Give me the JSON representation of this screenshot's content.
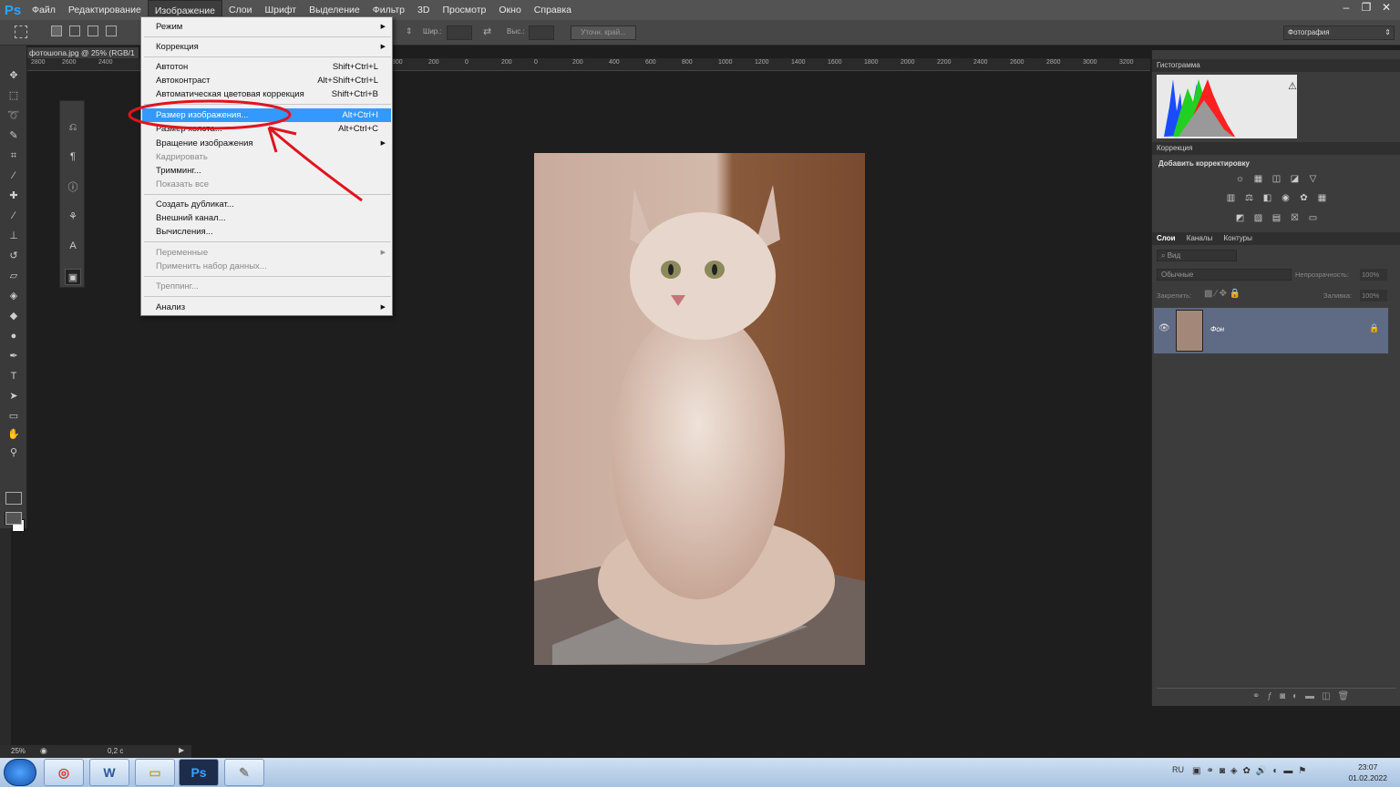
{
  "app": {
    "logo": "Ps"
  },
  "menubar": {
    "items": [
      "Файл",
      "Редактирование",
      "Изображение",
      "Слои",
      "Шрифт",
      "Выделение",
      "Фильтр",
      "3D",
      "Просмотр",
      "Окно",
      "Справка"
    ],
    "active": "Изображение"
  },
  "window_controls": [
    "–",
    "❐",
    "✕"
  ],
  "options_bar": {
    "width_label": "Шир.:",
    "height_label": "Выс.:",
    "refine_edge": "Уточн. край...",
    "workspace": "Фотография"
  },
  "document": {
    "tab_title": "фотошопа.jpg @ 25% (RGB/1",
    "ruler_ticks": [
      "2800",
      "2600",
      "2400",
      "2200",
      "300",
      "200",
      "400",
      "600",
      "800",
      "1000",
      "1200",
      "1400",
      "1600",
      "1800",
      "2000",
      "2200",
      "2400",
      "2600",
      "2800",
      "3000",
      "3200"
    ],
    "ruler_ticks_right": [
      "300",
      "200",
      "0",
      "200",
      "400",
      "600",
      "800",
      "1000",
      "1200",
      "1400",
      "1600",
      "1800",
      "2000",
      "2200",
      "2400",
      "2600",
      "2800",
      "3000",
      "3200"
    ]
  },
  "image_menu": {
    "items": [
      {
        "label": "Режим",
        "shortcut": "",
        "submenu": true,
        "disabled": false
      },
      {
        "label": "Коррекция",
        "shortcut": "",
        "submenu": true,
        "disabled": false
      },
      {
        "label": "Автотон",
        "shortcut": "Shift+Ctrl+L",
        "submenu": false,
        "disabled": false
      },
      {
        "label": "Автоконтраст",
        "shortcut": "Alt+Shift+Ctrl+L",
        "submenu": false,
        "disabled": false
      },
      {
        "label": "Автоматическая цветовая коррекция",
        "shortcut": "Shift+Ctrl+B",
        "submenu": false,
        "disabled": false
      },
      {
        "label": "Размер изображения...",
        "shortcut": "Alt+Ctrl+I",
        "submenu": false,
        "disabled": false,
        "selected": true
      },
      {
        "label": "Размер холста...",
        "shortcut": "Alt+Ctrl+C",
        "submenu": false,
        "disabled": false
      },
      {
        "label": "Вращение изображения",
        "shortcut": "",
        "submenu": true,
        "disabled": false
      },
      {
        "label": "Кадрировать",
        "shortcut": "",
        "submenu": false,
        "disabled": true
      },
      {
        "label": "Тримминг...",
        "shortcut": "",
        "submenu": false,
        "disabled": false
      },
      {
        "label": "Показать все",
        "shortcut": "",
        "submenu": false,
        "disabled": true
      },
      {
        "label": "Создать дубликат...",
        "shortcut": "",
        "submenu": false,
        "disabled": false
      },
      {
        "label": "Внешний канал...",
        "shortcut": "",
        "submenu": false,
        "disabled": false
      },
      {
        "label": "Вычисления...",
        "shortcut": "",
        "submenu": false,
        "disabled": false
      },
      {
        "label": "Переменные",
        "shortcut": "",
        "submenu": true,
        "disabled": true
      },
      {
        "label": "Применить набор данных...",
        "shortcut": "",
        "submenu": false,
        "disabled": true
      },
      {
        "label": "Треппинг...",
        "shortcut": "",
        "submenu": false,
        "disabled": true
      },
      {
        "label": "Анализ",
        "shortcut": "",
        "submenu": true,
        "disabled": false
      }
    ]
  },
  "panels": {
    "histogram_title": "Гистограмма",
    "adjustments_title": "Коррекция",
    "adjustments_subtitle": "Добавить корректировку",
    "layers_tabs": [
      "Слои",
      "Каналы",
      "Контуры"
    ],
    "layer_filter": "Вид",
    "blend_mode": "Обычные",
    "opacity_label": "Непрозрачность:",
    "opacity_value": "100%",
    "lock_label": "Закрепить:",
    "fill_label": "Заливка:",
    "fill_value": "100%",
    "layer_name": "Фон"
  },
  "status": {
    "zoom": "25%",
    "timing": "0,2 с"
  },
  "taskbar": {
    "lang": "RU",
    "time": "23:07",
    "date": "01.02.2022"
  },
  "colors": {
    "accent": "#3399ff",
    "annotation": "#e0141e"
  }
}
